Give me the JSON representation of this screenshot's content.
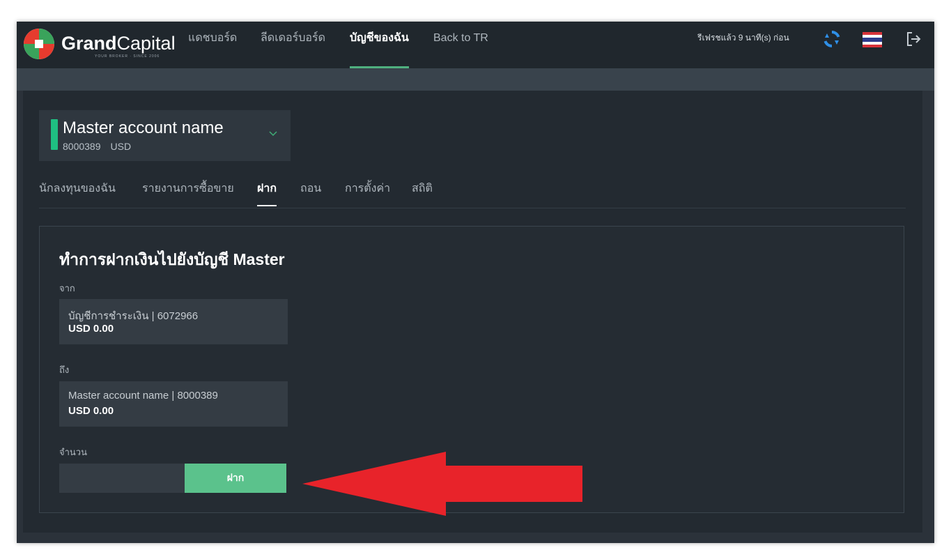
{
  "brand": {
    "name_bold": "Grand",
    "name_light": "Capital",
    "tagline": "YOUR BROKER · SINCE 2006"
  },
  "nav": [
    {
      "label": "แดชบอร์ด",
      "active": false
    },
    {
      "label": "ลีดเดอร์บอร์ด",
      "active": false
    },
    {
      "label": "บัญชีของฉัน",
      "active": true
    },
    {
      "label": "Back to TR",
      "active": false
    }
  ],
  "header": {
    "refresh_text": "รีเฟรชแล้ว 9 นาที(s) ก่อน",
    "icons": [
      "refresh-icon",
      "thailand-flag-icon",
      "menu-icon",
      "logout-icon"
    ]
  },
  "account": {
    "name": "Master account name",
    "number": "8000389",
    "currency": "USD"
  },
  "tabs": [
    {
      "label": "นักลงทุนของฉัน",
      "active": false
    },
    {
      "label": "รายงานการซื้อขาย",
      "active": false
    },
    {
      "label": "ฝาก",
      "active": true
    },
    {
      "label": "ถอน",
      "active": false
    },
    {
      "label": "การตั้งค่า",
      "active": false
    },
    {
      "label": "สถิติ",
      "active": false
    }
  ],
  "deposit_form": {
    "title": "ทำการฝากเงินไปยังบัญชี Master",
    "from_label": "จาก",
    "from_account": "บัญชีการชำระเงิน | 6072966",
    "from_balance": "USD 0.00",
    "to_label": "ถึง",
    "to_account": "Master account name | 8000389",
    "to_balance": "USD 0.00",
    "amount_label": "จำนวน",
    "amount_value": "",
    "submit_label": "ฝาก"
  },
  "colors": {
    "accent_green": "#5bc28c",
    "active_bar": "#1fbf82",
    "annotation_arrow": "#e8232a",
    "refresh_icon": "#2f8fe6"
  }
}
